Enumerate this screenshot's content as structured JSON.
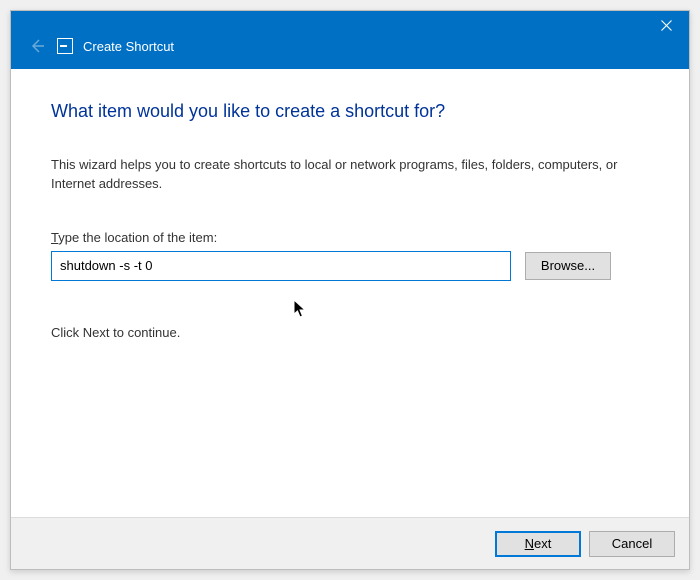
{
  "titlebar": {
    "title": "Create Shortcut"
  },
  "content": {
    "heading": "What item would you like to create a shortcut for?",
    "description": "This wizard helps you to create shortcuts to local or network programs, files, folders, computers, or Internet addresses.",
    "field_label_prefix": "T",
    "field_label_rest": "ype the location of the item:",
    "location_value": "shutdown -s -t 0",
    "browse_label": "Browse...",
    "continue_text": "Click Next to continue."
  },
  "footer": {
    "next_prefix": "N",
    "next_rest": "ext",
    "cancel_label": "Cancel"
  },
  "colors": {
    "accent": "#0070c5",
    "heading": "#003399",
    "focus": "#0078d7"
  }
}
